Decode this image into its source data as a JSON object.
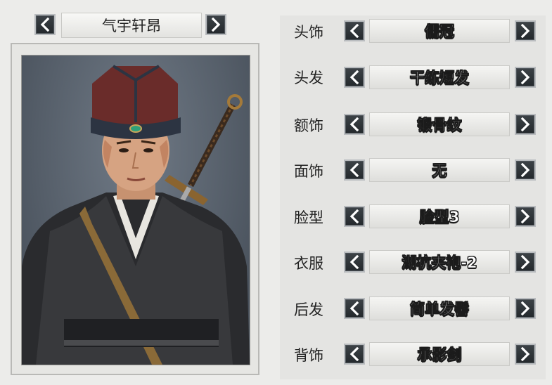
{
  "character": {
    "name": "气宇轩昂"
  },
  "options": [
    {
      "label": "头饰",
      "value": "儒冠"
    },
    {
      "label": "头发",
      "value": "干练短发"
    },
    {
      "label": "额饰",
      "value": "锻骨纹"
    },
    {
      "label": "面饰",
      "value": "无"
    },
    {
      "label": "脸型",
      "value": "脸型3"
    },
    {
      "label": "衣服",
      "value": "湖杭夹袍-2"
    },
    {
      "label": "后发",
      "value": "简单发髻"
    },
    {
      "label": "背饰",
      "value": "承影剑"
    }
  ],
  "icons": {
    "prev": "chevron-left-icon",
    "next": "chevron-right-icon"
  },
  "colors": {
    "button_bg": "#2c3135",
    "panel_bg": "#e4e4e2",
    "page_bg": "#ececea"
  }
}
